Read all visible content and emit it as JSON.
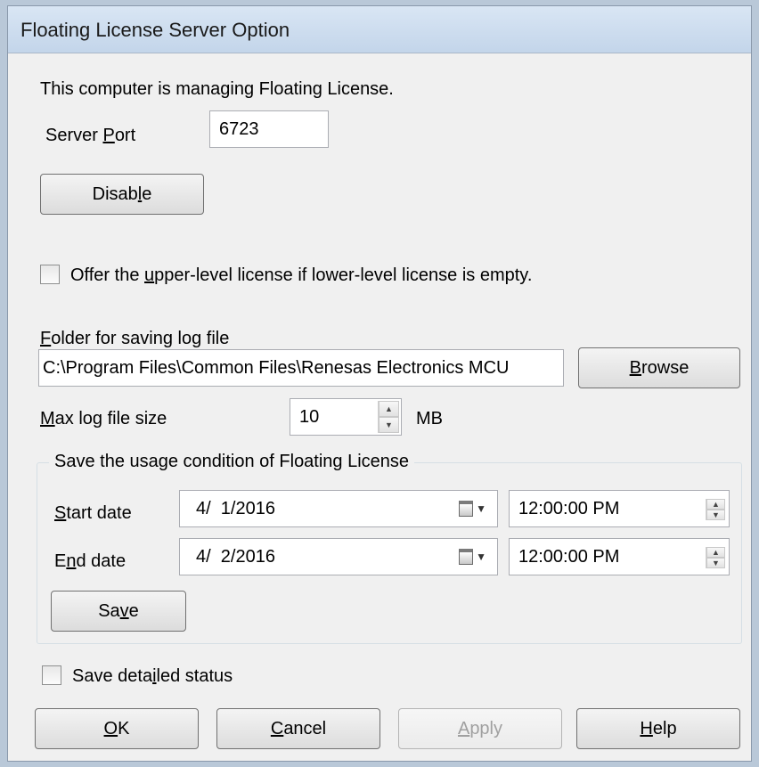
{
  "window": {
    "title": "Floating License Server Option"
  },
  "status_text": "This computer is managing Floating License.",
  "server_port": {
    "label_pre": "Server ",
    "label_accel": "P",
    "label_post": "ort",
    "value": "6723"
  },
  "disable_button": {
    "pre": "Disab",
    "accel": "l",
    "post": "e"
  },
  "offer_checkbox": {
    "pre": "Offer the ",
    "accel": "u",
    "post": "pper-level license if lower-level license is empty.",
    "checked": false
  },
  "log_folder": {
    "label_accel": "F",
    "label_post": "older for saving log file",
    "path": "C:\\Program Files\\Common Files\\Renesas Electronics MCU",
    "browse_accel": "B",
    "browse_post": "rowse"
  },
  "max_log": {
    "label_accel": "M",
    "label_post": "ax log file size",
    "value": "10",
    "unit": "MB"
  },
  "usage_group": {
    "title": "Save the usage condition of Floating License",
    "start_label_accel": "S",
    "start_label_post": "tart date",
    "start_date": "4/  1/2016",
    "start_time": "12:00:00 PM",
    "end_label_pre": "E",
    "end_label_accel": "n",
    "end_label_post": "d date",
    "end_date": "4/  2/2016",
    "end_time": "12:00:00 PM",
    "save_pre": "Sa",
    "save_accel": "v",
    "save_post": "e"
  },
  "detail_checkbox": {
    "pre": "Save deta",
    "accel": "i",
    "post": "led status",
    "checked": false
  },
  "footer": {
    "ok_accel": "O",
    "ok_post": "K",
    "cancel_accel": "C",
    "cancel_post": "ancel",
    "apply_accel": "A",
    "apply_post": "pply",
    "apply_enabled": false,
    "help_accel": "H",
    "help_post": "elp"
  },
  "colors": {
    "title_bar": "#c3d5ea",
    "dialog_bg": "#f0f0f0",
    "border": "#707070"
  }
}
